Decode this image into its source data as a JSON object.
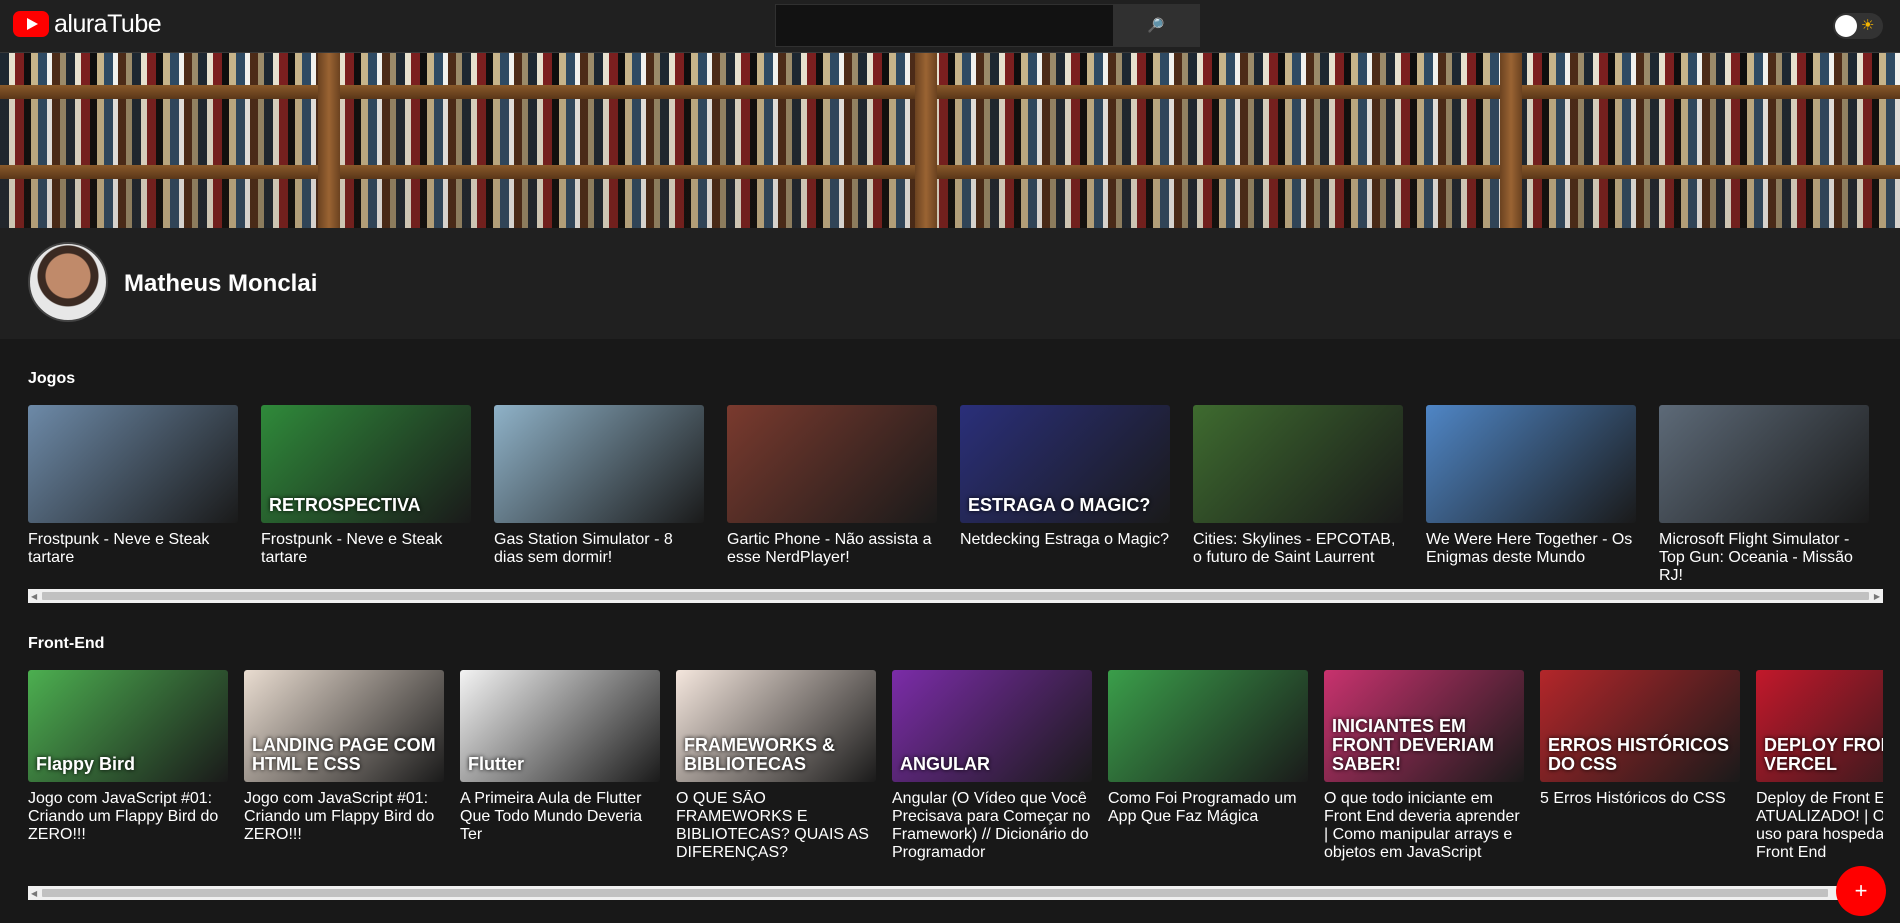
{
  "header": {
    "logo_text": "aluraTube",
    "search_value": "",
    "search_button_glyph": "🔎",
    "theme_toggle_icon": "sun-icon",
    "colors": {
      "topbar": "#202020",
      "background": "#181818",
      "accent": "#ff0000"
    }
  },
  "profile": {
    "name": "Matheus Monclai"
  },
  "playlists": [
    {
      "title": "Jogos",
      "videos": [
        {
          "title": "Frostpunk - Neve e Steak tartare",
          "thumb_color": "#6d8aa8",
          "caption": ""
        },
        {
          "title": "Frostpunk - Neve e Steak tartare",
          "thumb_color": "#2f8a3a",
          "caption": "RETROSPECTIVA"
        },
        {
          "title": "Gas Station Simulator - 8 dias sem dormir!",
          "thumb_color": "#8fb2c8",
          "caption": ""
        },
        {
          "title": "Gartic Phone - Não assista a esse NerdPlayer!",
          "thumb_color": "#7a3a2e",
          "caption": ""
        },
        {
          "title": "Netdecking Estraga o Magic?",
          "thumb_color": "#2a2f7a",
          "caption": "ESTRAGA O MAGIC?"
        },
        {
          "title": "Cities: Skylines - EPCOTAB, o futuro de Saint Laurrent",
          "thumb_color": "#3e6b2f",
          "caption": ""
        },
        {
          "title": "We Were Here Together - Os Enigmas deste Mundo",
          "thumb_color": "#4f86c6",
          "caption": ""
        },
        {
          "title": "Microsoft Flight Simulator - Top Gun: Oceania - Missão RJ!",
          "thumb_color": "#5d6a78",
          "caption": ""
        }
      ]
    },
    {
      "title": "Front-End",
      "videos": [
        {
          "title": "Jogo com JavaScript #01: Criando um Flappy Bird do ZERO!!!",
          "thumb_color": "#4caf50",
          "caption": "Flappy Bird"
        },
        {
          "title": "Jogo com JavaScript #01: Criando um Flappy Bird do ZERO!!!",
          "thumb_color": "#e9dcd0",
          "caption": "LANDING PAGE COM HTML E CSS"
        },
        {
          "title": "A Primeira Aula de Flutter Que Todo Mundo Deveria Ter",
          "thumb_color": "#f3f3f3",
          "caption": "Flutter"
        },
        {
          "title": "O QUE SÃO FRAMEWORKS E BIBLIOTECAS? QUAIS AS DIFERENÇAS?",
          "thumb_color": "#f4e6dd",
          "caption": "FRAMEWORKS & BIBLIOTECAS"
        },
        {
          "title": "Angular (O Vídeo que Você Precisava para Começar no Framework) // Dicionário do Programador",
          "thumb_color": "#7b2ca8",
          "caption": "ANGULAR"
        },
        {
          "title": "Como Foi Programado um App Que Faz Mágica",
          "thumb_color": "#3a9e4a",
          "caption": ""
        },
        {
          "title": "O que todo iniciante em Front End deveria aprender | Como manipular arrays e objetos em JavaScript",
          "thumb_color": "#c8326e",
          "caption": "INICIANTES EM FRONT DEVERIAM SABER!"
        },
        {
          "title": "5 Erros Históricos do CSS",
          "thumb_color": "#b3262a",
          "caption": "ERROS HISTÓRICOS DO CSS"
        },
        {
          "title": "Deploy de Front End ATUALIZADO! | O que eu uso para hospedagem de Front End",
          "thumb_color": "#c2182b",
          "caption": "DEPLOY FRONT END VERCEL"
        }
      ]
    }
  ],
  "fab_label": "+"
}
